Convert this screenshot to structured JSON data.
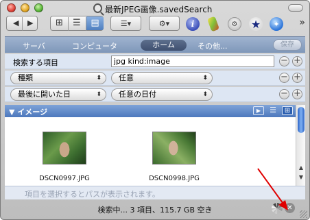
{
  "window": {
    "title": "最新JPEG画像.savedSearch"
  },
  "toolbar": {
    "back_label": "◀",
    "forward_label": "▶",
    "view_icon_label": "⊞",
    "view_list_label": "☰",
    "view_column_label": "▤",
    "arrange_label": "☰▾",
    "action_label": "⚙▾",
    "info_label": "i",
    "overflow_label": "»"
  },
  "scope": {
    "items": [
      "サーバ",
      "コンピュータ",
      "ホーム",
      "その他..."
    ],
    "selected": "ホーム",
    "save_label": "保存"
  },
  "criteria": [
    {
      "label": "検索する項目",
      "value": "jpg kind:image"
    },
    {
      "popup1": "種類",
      "popup2": "任意"
    },
    {
      "popup1": "最後に開いた日",
      "popup2": "任意の日付"
    }
  ],
  "results": {
    "group_title": "▼ イメージ",
    "items": [
      {
        "filename": "DSCN0997.JPG"
      },
      {
        "filename": "DSCN0998.JPG"
      }
    ]
  },
  "pathbar": {
    "text": "項目を選択するとパスが表示されます。"
  },
  "status": {
    "text": "検索中...  3 項目、115.7 GB 空き"
  },
  "colors": {
    "scope_bar": "#8aa0c0",
    "group_header": "#5f87c8",
    "annotation_arrow": "#e00000"
  }
}
